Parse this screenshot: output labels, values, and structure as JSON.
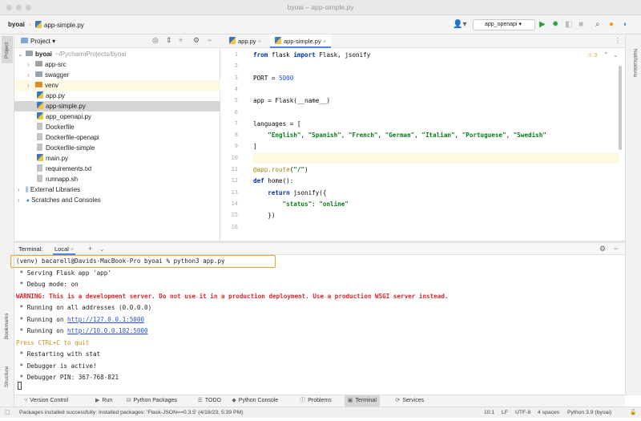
{
  "window": {
    "title": "byoai – app-simple.py"
  },
  "nav": {
    "project": "byoai",
    "file": "app-simple.py",
    "run_config": "app_openapi"
  },
  "project_panel": {
    "title": "Project",
    "items": [
      {
        "label": "byoai",
        "path": "~/PycharmProjects/byoai",
        "type": "root"
      },
      {
        "label": "app-src",
        "type": "folder"
      },
      {
        "label": "swagger",
        "type": "folder"
      },
      {
        "label": "venv",
        "type": "venv"
      },
      {
        "label": "app.py",
        "type": "py"
      },
      {
        "label": "app-simple.py",
        "type": "py",
        "selected": true
      },
      {
        "label": "app_openapi.py",
        "type": "py"
      },
      {
        "label": "Dockerfile",
        "type": "file"
      },
      {
        "label": "Dockerfile-openapi",
        "type": "file"
      },
      {
        "label": "Dockerfile-simple",
        "type": "file"
      },
      {
        "label": "main.py",
        "type": "py"
      },
      {
        "label": "requirements.txt",
        "type": "file"
      },
      {
        "label": "runnapp.sh",
        "type": "file"
      },
      {
        "label": "External Libraries",
        "type": "lib"
      },
      {
        "label": "Scratches and Consoles",
        "type": "lib"
      }
    ]
  },
  "tabs": [
    {
      "label": "app.py"
    },
    {
      "label": "app-simple.py",
      "active": true
    }
  ],
  "editor": {
    "warnings": "3",
    "lines": [
      [
        [
          "from",
          "k"
        ],
        [
          " flask ",
          "p"
        ],
        [
          "import",
          "k"
        ],
        [
          " Flask, jsonify",
          "p"
        ]
      ],
      [],
      [
        [
          "PORT = ",
          "p"
        ],
        [
          "5000",
          "n"
        ]
      ],
      [],
      [
        [
          "app = Flask(__name__)",
          "p"
        ]
      ],
      [],
      [
        [
          "languages = [",
          "p"
        ]
      ],
      [
        [
          "    ",
          "p"
        ],
        [
          "\"English\"",
          "s"
        ],
        [
          ", ",
          "p"
        ],
        [
          "\"Spanish\"",
          "s"
        ],
        [
          ", ",
          "p"
        ],
        [
          "\"French\"",
          "s"
        ],
        [
          ", ",
          "p"
        ],
        [
          "\"German\"",
          "s"
        ],
        [
          ", ",
          "p"
        ],
        [
          "\"Italian\"",
          "s"
        ],
        [
          ", ",
          "p"
        ],
        [
          "\"Portuguese\"",
          "s"
        ],
        [
          ", ",
          "p"
        ],
        [
          "\"Swedish\"",
          "s"
        ]
      ],
      [
        [
          "]",
          "p"
        ]
      ],
      [],
      [
        [
          "@app.route",
          "d"
        ],
        [
          "(",
          "p"
        ],
        [
          "\"/\"",
          "s"
        ],
        [
          ")",
          "p"
        ]
      ],
      [
        [
          "def",
          "k"
        ],
        [
          " home():",
          "p"
        ]
      ],
      [
        [
          "    ",
          "p"
        ],
        [
          "return",
          "k"
        ],
        [
          " jsonify({",
          "p"
        ]
      ],
      [
        [
          "        ",
          "p"
        ],
        [
          "\"status\"",
          "s"
        ],
        [
          ": ",
          "p"
        ],
        [
          "\"online\"",
          "s"
        ]
      ],
      [
        [
          "    })",
          "p"
        ]
      ],
      []
    ]
  },
  "terminal": {
    "label": "Terminal:",
    "tab": "Local",
    "lines": [
      {
        "text": "(venv) bacarell@Davids-MacBook-Pro byoai % python3 app.py",
        "style": ""
      },
      {
        "text": " * Serving Flask app 'app'",
        "style": ""
      },
      {
        "text": " * Debug mode: on",
        "style": ""
      },
      {
        "text": "WARNING: This is a development server. Do not use it in a production deployment. Use a production WSGI server instead.",
        "style": "warn"
      },
      {
        "text": " * Running on all addresses (0.0.0.0)",
        "style": ""
      },
      {
        "text": " * Running on ",
        "style": "",
        "link": "http://127.0.0.1:5000"
      },
      {
        "text": " * Running on ",
        "style": "",
        "link": "http://10.0.0.182:5000"
      },
      {
        "text": "Press CTRL+C to quit",
        "style": "yel"
      },
      {
        "text": " * Restarting with stat",
        "style": ""
      },
      {
        "text": " * Debugger is active!",
        "style": ""
      },
      {
        "text": " * Debugger PIN: 367-768-821",
        "style": ""
      }
    ]
  },
  "stripes": {
    "project": "Project",
    "bookmarks": "Bookmarks",
    "structure": "Structure",
    "notifications": "Notifications"
  },
  "toolwindows": [
    {
      "label": "Version Control",
      "icon": "⑂"
    },
    {
      "label": "Run",
      "icon": "▶"
    },
    {
      "label": "Python Packages",
      "icon": "⛁"
    },
    {
      "label": "TODO",
      "icon": "☰"
    },
    {
      "label": "Python Console",
      "icon": "◆"
    },
    {
      "label": "Problems",
      "icon": "ⓘ"
    },
    {
      "label": "Terminal",
      "icon": "▣",
      "active": true
    },
    {
      "label": "Services",
      "icon": "⟳"
    }
  ],
  "status": {
    "message": "Packages installed successfully: Installed packages: 'Flask-JSON==0.3.5' (4/18/23, 5:39 PM)",
    "position": "10:1",
    "line_sep": "LF",
    "encoding": "UTF-8",
    "indent": "4 spaces",
    "interpreter": "Python 3.9 (byoai)"
  }
}
